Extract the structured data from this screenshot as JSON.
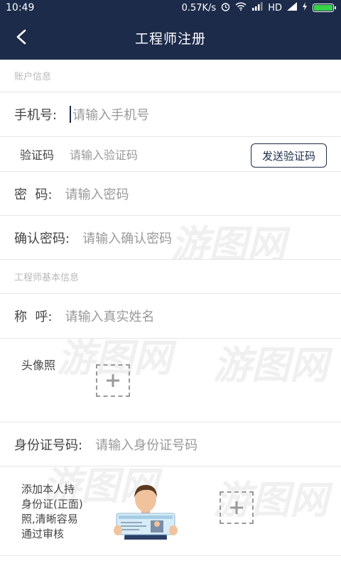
{
  "status_bar": {
    "time": "10:49",
    "speed": "0.57K/s",
    "network": "HD",
    "battery_level": 1.0
  },
  "nav": {
    "title": "工程师注册"
  },
  "account_section": {
    "title": "账户信息",
    "phone": {
      "label": "手机号:",
      "placeholder": "请输入手机号"
    },
    "code": {
      "label": "验证码",
      "placeholder": "请输入验证码",
      "send_button": "发送验证码"
    },
    "password": {
      "label": "密  码:",
      "placeholder": "请输入密码"
    },
    "confirm": {
      "label": "确认密码:",
      "placeholder": "请输入确认密码"
    }
  },
  "basic_section": {
    "title": "工程师基本信息",
    "name": {
      "label": "称  呼:",
      "placeholder": "请输入真实姓名"
    },
    "avatar": {
      "label": "头像照"
    },
    "id_number": {
      "label": "身份证号码:",
      "placeholder": "请输入身份证号码"
    },
    "id_card": {
      "lines": [
        "添加本人持",
        "身份证(正面)",
        "照,清晰容易",
        "通过审核"
      ]
    }
  },
  "watermark_text": "游图网"
}
